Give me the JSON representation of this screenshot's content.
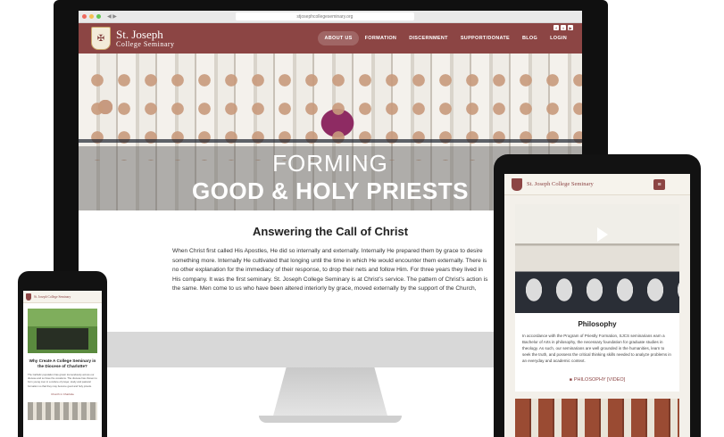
{
  "desktop": {
    "url": "stjosephcollegeseminary.org",
    "logo": {
      "line1": "St. Joseph",
      "line2": "College Seminary"
    },
    "nav": [
      "ABOUT US",
      "FORMATION",
      "DISCERNMENT",
      "SUPPORT/DONATE",
      "BLOG",
      "LOGIN"
    ],
    "social": [
      "f",
      "t",
      "▶"
    ],
    "hero": {
      "line1": "FORMING",
      "line2": "GOOD & HOLY PRIESTS"
    },
    "heading": "Answering the Call of Christ",
    "body": "When Christ first called His Apostles, He did so internally and externally. Internally He prepared them by grace to desire something more. Internally He cultivated that longing until the time in which He would encounter them externally. There is no other explanation for the immediacy of their response, to drop their nets and follow Him. For three years they lived in His company. It was the first seminary. St. Joseph College Seminary is at Christ’s service. The pattern of Christ’s action is the same. Men come to us who have been altered interiorly by grace, moved externally by the support of the Church,"
  },
  "tablet": {
    "title": "St. Joseph College Seminary",
    "menu_icon": "≡",
    "card_heading": "Philosophy",
    "card_text": "In accordance with the Program of Priestly Formation, SJCS seminarians earn a Bachelor of Arts in philosophy, the necessary foundation for graduate studies in theology. As such, our seminarians are well grounded in the humanities, learn to seek the truth, and possess the critical thinking skills needed to analyze problems in an everyday and academic context.",
    "link_icon": "■",
    "link_label": "PHILOSOPHY [VIDEO]"
  },
  "phone": {
    "title": "St. Joseph College Seminary",
    "heading": "Why Create A College Seminary in the Diocese of Charlotte?",
    "text": "The Catholic population has grown tremendously across our diocese and so have the vocations. The diocese has chosen to form young men in a culture of prayer, study and pastoral formation so that they may become good and holy priests.",
    "link": "Church in Charlotte"
  }
}
